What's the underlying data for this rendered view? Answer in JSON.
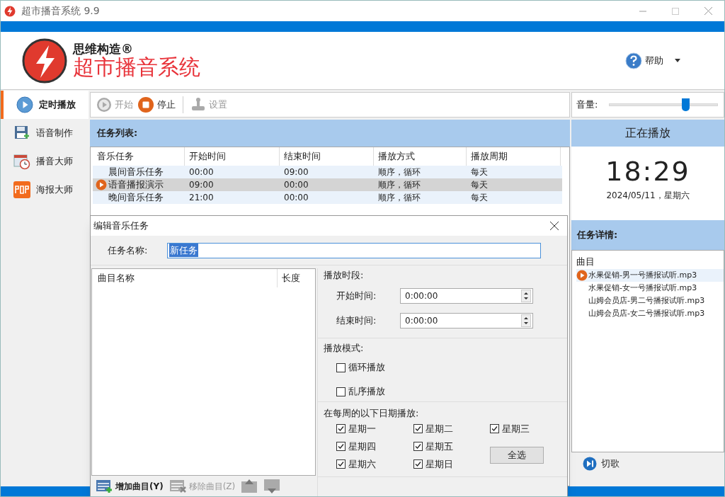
{
  "window": {
    "title": "超市播音系统 9.9"
  },
  "logo": {
    "brand": "思维构造®",
    "product": "超市播音系统"
  },
  "help": {
    "label": "帮助"
  },
  "sidebar": {
    "items": [
      {
        "label": "定时播放",
        "selected": true
      },
      {
        "label": "语音制作",
        "selected": false
      },
      {
        "label": "播音大师",
        "selected": false
      },
      {
        "label": "海报大师",
        "selected": false
      }
    ]
  },
  "toolbar": {
    "buttons": [
      {
        "kind": "start",
        "label": "开始",
        "disabled": true
      },
      {
        "kind": "stop",
        "label": "停止",
        "disabled": false
      },
      {
        "kind": "settings",
        "label": "设置",
        "disabled": true
      }
    ]
  },
  "volume": {
    "label": "音量:",
    "level": 0.7
  },
  "task_list": {
    "title": "任务列表:",
    "columns": [
      "音乐任务",
      "开始时间",
      "结束时间",
      "播放方式",
      "播放周期"
    ],
    "rows": [
      {
        "cells": [
          "晨间音乐任务",
          "00:00",
          "09:00",
          "顺序，循环",
          "每天"
        ],
        "selected": false
      },
      {
        "cells": [
          "语音播报演示",
          "09:00",
          "00:00",
          "顺序，循环",
          "每天"
        ],
        "selected": true
      },
      {
        "cells": [
          "晚间音乐任务",
          "21:00",
          "00:00",
          "顺序，循环",
          "每天"
        ],
        "selected": false
      }
    ]
  },
  "now_playing": {
    "title": "正在播放",
    "time": "18:29",
    "date": "2024/05/11，星期六"
  },
  "task_details": {
    "title": "任务详情:",
    "column": "曲目",
    "songs": [
      {
        "name": "水果促销-男一号播报试听.mp3",
        "playing": true
      },
      {
        "name": "水果促销-女一号播报试听.mp3",
        "playing": false
      },
      {
        "name": "山姆会员店-男二号播报试听.mp3",
        "playing": false
      },
      {
        "name": "山姆会员店-女二号播报试听.mp3",
        "playing": false
      }
    ],
    "skip_button": "切歌"
  },
  "dialog": {
    "title": "编辑音乐任务",
    "name_label": "任务名称:",
    "name_value": "新任务",
    "song_columns": [
      "曲目名称",
      "长度"
    ],
    "song_buttons": [
      {
        "kind": "add",
        "label": "增加曲目(Y)",
        "disabled": false
      },
      {
        "kind": "remove",
        "label": "移除曲目(Z)",
        "disabled": true
      },
      {
        "kind": "up",
        "disabled": true
      },
      {
        "kind": "down",
        "disabled": true
      }
    ],
    "period": {
      "title": "播放时段:",
      "fields": [
        {
          "label": "开始时间:",
          "value": "0:00:00"
        },
        {
          "label": "结束时间:",
          "value": "0:00:00"
        }
      ]
    },
    "mode": {
      "title": "播放模式:",
      "options": [
        {
          "label": "循环播放",
          "checked": false
        },
        {
          "label": "乱序播放",
          "checked": false
        }
      ]
    },
    "days": {
      "title": "在每周的以下日期播放:",
      "items": [
        {
          "label": "星期一",
          "checked": true
        },
        {
          "label": "星期二",
          "checked": true
        },
        {
          "label": "星期三",
          "checked": true
        },
        {
          "label": "星期四",
          "checked": true
        },
        {
          "label": "星期五",
          "checked": true
        },
        {
          "label": "星期六",
          "checked": true
        },
        {
          "label": "星期日",
          "checked": true
        }
      ],
      "select_all": "全选"
    }
  }
}
